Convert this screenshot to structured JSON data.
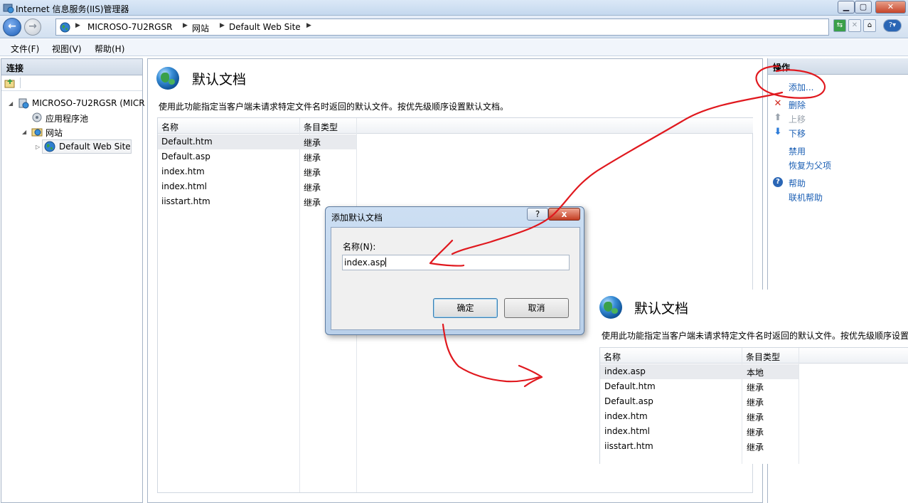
{
  "window": {
    "title": "Internet 信息服务(IIS)管理器"
  },
  "address": {
    "crumbs": [
      "MICROSO-7U2RGSR",
      "网站",
      "Default Web Site"
    ]
  },
  "menu": [
    "文件(F)",
    "视图(V)",
    "帮助(H)"
  ],
  "connections": {
    "header": "连接",
    "tree": {
      "server": "MICROSO-7U2RGSR (MICR",
      "app_pools": "应用程序池",
      "sites": "网站",
      "site": "Default Web Site"
    }
  },
  "feature": {
    "title": "默认文档",
    "description": "使用此功能指定当客户端未请求特定文件名时返回的默认文件。按优先级顺序设置默认文档。",
    "columns": [
      "名称",
      "条目类型"
    ],
    "rows": [
      [
        "Default.htm",
        "继承"
      ],
      [
        "Default.asp",
        "继承"
      ],
      [
        "index.htm",
        "继承"
      ],
      [
        "index.html",
        "继承"
      ],
      [
        "iisstart.htm",
        "继承"
      ]
    ]
  },
  "actions": {
    "header": "操作",
    "items": [
      "添加...",
      "删除",
      "上移",
      "下移",
      "禁用",
      "恢复为父项",
      "帮助",
      "联机帮助"
    ]
  },
  "dialog": {
    "title": "添加默认文档",
    "help_label": "?",
    "close_label": "x",
    "name_label": "名称(N):",
    "name_value": "index.asp",
    "ok_label": "确定",
    "cancel_label": "取消"
  },
  "result": {
    "title": "默认文档",
    "description": "使用此功能指定当客户端未请求特定文件名时返回的默认文件。按优先级顺序设置",
    "columns": [
      "名称",
      "条目类型"
    ],
    "rows": [
      [
        "index.asp",
        "本地"
      ],
      [
        "Default.htm",
        "继承"
      ],
      [
        "Default.asp",
        "继承"
      ],
      [
        "index.htm",
        "继承"
      ],
      [
        "index.html",
        "继承"
      ],
      [
        "iisstart.htm",
        "继承"
      ]
    ]
  },
  "colors": {
    "annotation": "#e0181e",
    "link": "#1b5fb4"
  }
}
